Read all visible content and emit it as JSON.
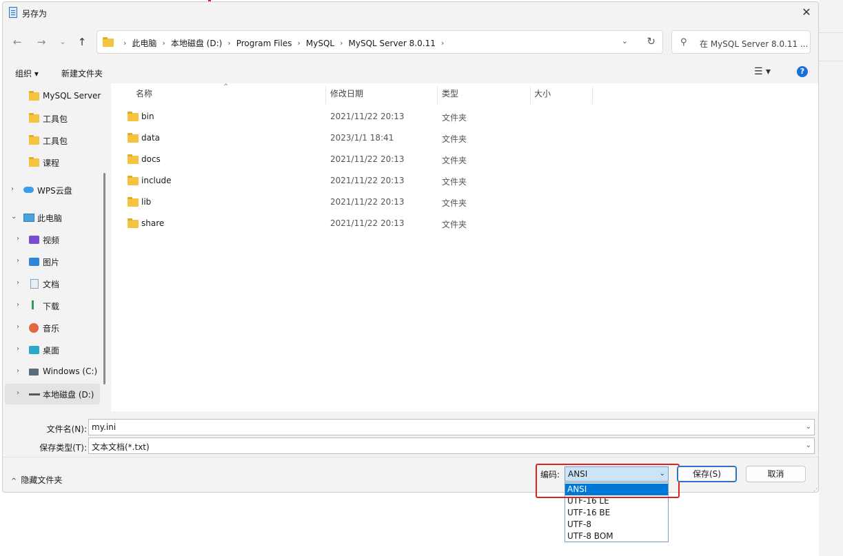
{
  "window": {
    "title": "另存为",
    "close_glyph": "✕"
  },
  "nav_buttons": {
    "back": "←",
    "forward": "→",
    "recent": "⌄",
    "up": "↑"
  },
  "address": {
    "crumbs": [
      "此电脑",
      "本地磁盘 (D:)",
      "Program Files",
      "MySQL",
      "MySQL Server 8.0.11"
    ],
    "separator": "›",
    "dropdown_glyph": "⌄",
    "refresh_glyph": "↻"
  },
  "search": {
    "placeholder": "在 MySQL Server 8.0.11 ...",
    "icon_glyph": "⚲"
  },
  "toolbar": {
    "organize": "组织 ▾",
    "new_folder": "新建文件夹",
    "view_glyph": "☰ ▾",
    "help_glyph": "?"
  },
  "navpane": {
    "items": [
      {
        "label": "MySQL Server",
        "icon": "folder-icon"
      },
      {
        "label": "工具包",
        "icon": "folder-icon"
      },
      {
        "label": "工具包",
        "icon": "folder-icon"
      },
      {
        "label": "课程",
        "icon": "folder-icon"
      },
      {
        "label": "WPS云盘",
        "icon": "cloud-icon"
      },
      {
        "label": "此电脑",
        "icon": "computer-icon"
      },
      {
        "label": "视频",
        "icon": "video-icon"
      },
      {
        "label": "图片",
        "icon": "pictures-icon"
      },
      {
        "label": "文档",
        "icon": "documents-icon"
      },
      {
        "label": "下载",
        "icon": "download-icon"
      },
      {
        "label": "音乐",
        "icon": "music-icon"
      },
      {
        "label": "桌面",
        "icon": "desktop-icon"
      },
      {
        "label": "Windows (C:)",
        "icon": "windows-drive-icon"
      },
      {
        "label": "本地磁盘 (D:)",
        "icon": "drive-icon"
      }
    ],
    "chevron_right": "›",
    "chevron_down": "⌄"
  },
  "columns": {
    "name": "名称",
    "modified": "修改日期",
    "type": "类型",
    "size": "大小",
    "sort_glyph": "^"
  },
  "files": [
    {
      "name": "bin",
      "modified": "2021/11/22 20:13",
      "type": "文件夹"
    },
    {
      "name": "data",
      "modified": "2023/1/1 18:41",
      "type": "文件夹"
    },
    {
      "name": "docs",
      "modified": "2021/11/22 20:13",
      "type": "文件夹"
    },
    {
      "name": "include",
      "modified": "2021/11/22 20:13",
      "type": "文件夹"
    },
    {
      "name": "lib",
      "modified": "2021/11/22 20:13",
      "type": "文件夹"
    },
    {
      "name": "share",
      "modified": "2021/11/22 20:13",
      "type": "文件夹"
    }
  ],
  "form": {
    "filename_label": "文件名(N):",
    "filename_value": "my.ini",
    "filetype_label": "保存类型(T):",
    "filetype_value": "文本文档(*.txt)",
    "dropdown_glyph": "⌄"
  },
  "footer": {
    "hide_folders": "隐藏文件夹",
    "hide_caret": "^",
    "encoding_label": "编码:",
    "encoding_value": "ANSI",
    "encoding_options": [
      "ANSI",
      "UTF-16 LE",
      "UTF-16 BE",
      "UTF-8",
      "UTF-8 BOM"
    ],
    "save": "保存(S)",
    "cancel": "取消",
    "grip_glyph": "⋰"
  },
  "colors": {
    "accent": "#0078d7",
    "highlight_box": "#e02020",
    "folder": "#f5c342"
  }
}
